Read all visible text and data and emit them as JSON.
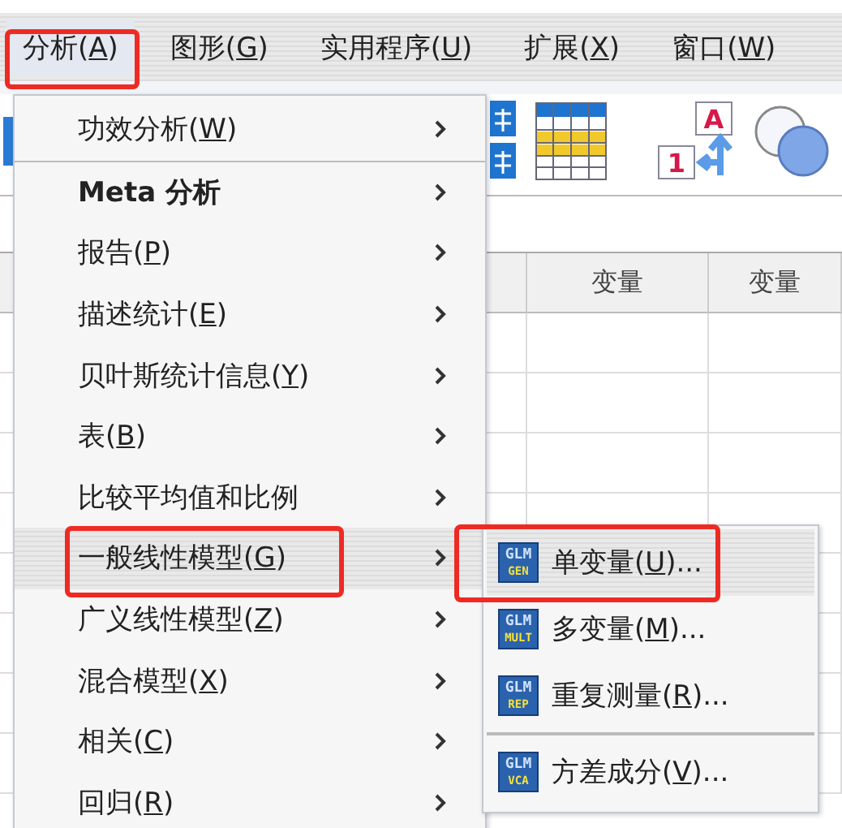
{
  "menubar": [
    {
      "before": "分析(",
      "key": "A",
      "after": ")",
      "selected": true,
      "annotated": true
    },
    {
      "before": "图形(",
      "key": "G",
      "after": ")",
      "selected": false,
      "annotated": false
    },
    {
      "before": "实用程序(",
      "key": "U",
      "after": ")",
      "selected": false,
      "annotated": false
    },
    {
      "before": "扩展(",
      "key": "X",
      "after": ")",
      "selected": false,
      "annotated": false
    },
    {
      "before": "窗口(",
      "key": "W",
      "after": ")",
      "selected": false,
      "annotated": false
    }
  ],
  "toolbar": {
    "label_icon_letter": "A",
    "label_icon_digit": "1"
  },
  "grid": {
    "columns": [
      "变量",
      "变量"
    ]
  },
  "menu": {
    "items": [
      {
        "kind": "item",
        "before": "功效分析(",
        "key": "W",
        "after": ")",
        "submenu": true,
        "selected": false,
        "annotated": false
      },
      {
        "kind": "separator"
      },
      {
        "kind": "item",
        "before": "Meta 分析",
        "submenu": true,
        "selected": false,
        "annotated": false
      },
      {
        "kind": "item",
        "before": "报告(",
        "key": "P",
        "after": ")",
        "submenu": true,
        "selected": false,
        "annotated": false
      },
      {
        "kind": "item",
        "before": "描述统计(",
        "key": "E",
        "after": ")",
        "submenu": true,
        "selected": false,
        "annotated": false
      },
      {
        "kind": "item",
        "before": "贝叶斯统计信息(",
        "key": "Y",
        "after": ")",
        "submenu": true,
        "selected": false,
        "annotated": false
      },
      {
        "kind": "item",
        "before": "表(",
        "key": "B",
        "after": ")",
        "submenu": true,
        "selected": false,
        "annotated": false
      },
      {
        "kind": "item",
        "before": "比较平均值和比例",
        "submenu": true,
        "selected": false,
        "annotated": false
      },
      {
        "kind": "item",
        "before": "一般线性模型(",
        "key": "G",
        "after": ")",
        "submenu": true,
        "selected": true,
        "annotated": true
      },
      {
        "kind": "item",
        "before": "广义线性模型(",
        "key": "Z",
        "after": ")",
        "submenu": true,
        "selected": false,
        "annotated": false
      },
      {
        "kind": "item",
        "before": "混合模型(",
        "key": "X",
        "after": ")",
        "submenu": true,
        "selected": false,
        "annotated": false
      },
      {
        "kind": "item",
        "before": "相关(",
        "key": "C",
        "after": ")",
        "submenu": true,
        "selected": false,
        "annotated": false
      },
      {
        "kind": "item",
        "before": "回归(",
        "key": "R",
        "after": ")",
        "submenu": true,
        "selected": false,
        "annotated": false
      }
    ]
  },
  "submenu": {
    "items": [
      {
        "kind": "item",
        "icon_top": "GLM",
        "icon_bottom": "GEN",
        "before": "单变量(",
        "key": "U",
        "after": ")...",
        "selected": true,
        "annotated": true
      },
      {
        "kind": "item",
        "icon_top": "GLM",
        "icon_bottom": "MULT",
        "before": "多变量(",
        "key": "M",
        "after": ")...",
        "selected": false,
        "annotated": false
      },
      {
        "kind": "item",
        "icon_top": "GLM",
        "icon_bottom": "REP",
        "before": "重复测量(",
        "key": "R",
        "after": ")...",
        "selected": false,
        "annotated": false
      },
      {
        "kind": "separator"
      },
      {
        "kind": "item",
        "icon_top": "GLM",
        "icon_bottom": "VCA",
        "before": "方差成分(",
        "key": "V",
        "after": ")...",
        "selected": false,
        "annotated": false
      }
    ]
  }
}
